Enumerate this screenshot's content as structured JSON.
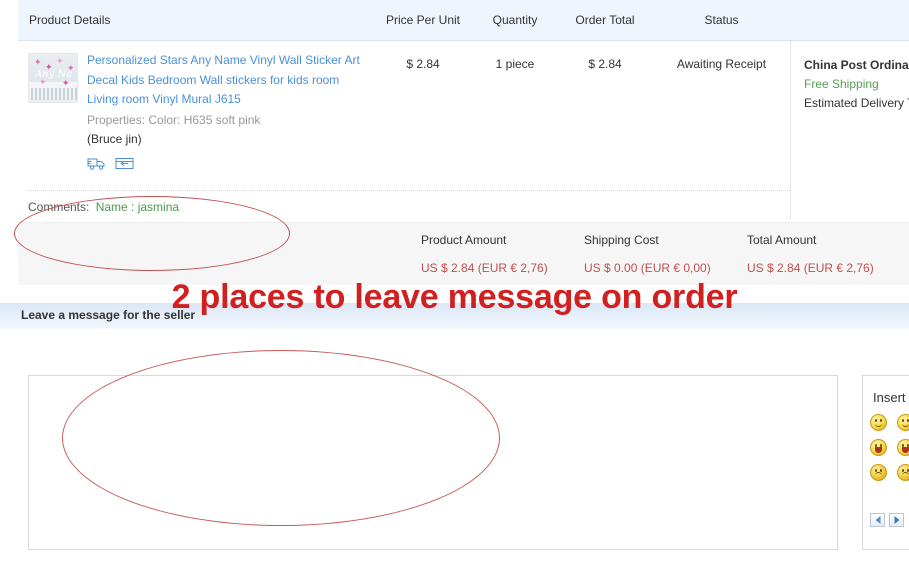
{
  "table": {
    "headers": {
      "product_details": "Product Details",
      "price_per_unit": "Price Per Unit",
      "quantity": "Quantity",
      "order_total": "Order Total",
      "status": "Status"
    },
    "row": {
      "product_title": "Personalized Stars Any Name Vinyl Wall Sticker Art Decal Kids Bedroom Wall stickers for kids room Living room Vinyl Mural J615",
      "properties": "Properties: Color: H635 soft pink",
      "seller": "(Bruce jin)",
      "price_per_unit": "$ 2.84",
      "quantity": "1 piece",
      "order_total": "$ 2.84",
      "status": "Awaiting Receipt",
      "thumb_text": "Any Name",
      "icons": {
        "shipping": "truck-icon",
        "return": "return-box-icon"
      }
    },
    "shipping": {
      "method": "China Post Ordinary Small Packet Plus",
      "free_shipping": "Free Shipping",
      "estimated_delivery": "Estimated Delivery Time"
    },
    "comments": {
      "label": "Comments:",
      "value": "Name : jasmina"
    },
    "totals": {
      "product_amount_label": "Product Amount",
      "product_amount_value": "US $ 2.84 (EUR € 2,76)",
      "shipping_cost_label": "Shipping Cost",
      "shipping_cost_value": "US $ 0.00 (EUR € 0,00)",
      "total_amount_label": "Total Amount",
      "total_amount_value": "US $ 2.84 (EUR € 2,76)"
    }
  },
  "annotation": {
    "text": "2 places to leave message on order",
    "color": "#d21f1f",
    "ellipse_color": "#c1504e"
  },
  "message_section": {
    "header_label": "Leave a message for the seller",
    "textarea_value": "",
    "textarea_placeholder": "",
    "emoticons": {
      "title": "Insert",
      "rows": [
        [
          "smile-emoticon",
          "wink-emoticon"
        ],
        [
          "laugh-emoticon",
          "crying-emoticon"
        ],
        [
          "sly-emoticon",
          "grin-emoticon"
        ]
      ],
      "prev_label": "◀",
      "next_label": "▶"
    }
  },
  "colors": {
    "link": "#4a90d9",
    "header_bg": "#eff5fc",
    "totals_bg": "#f6f6f6",
    "price_red": "#c0504d",
    "free_shipping_green": "#54a154",
    "comment_green": "#4a9a4a"
  }
}
